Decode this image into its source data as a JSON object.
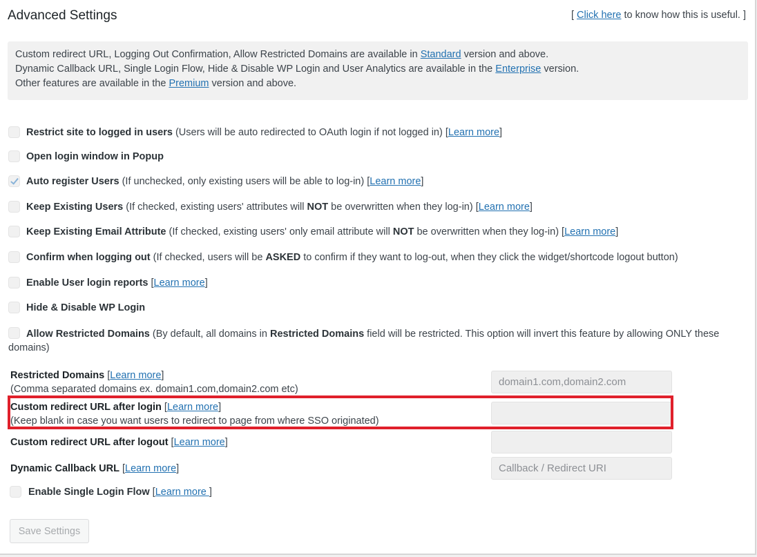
{
  "header": {
    "title": "Advanced Settings",
    "help_prefix": "[ ",
    "help_link": "Click here",
    "help_suffix": " to know how this is useful. ]"
  },
  "notice": {
    "line1_prefix": "Custom redirect URL, Logging Out Confirmation, Allow Restricted Domains are available in ",
    "line1_link": "Standard",
    "line1_suffix": " version and above.",
    "line2_prefix": "Dynamic Callback URL, Single Login Flow, Hide & Disable WP Login and User Analytics are available in the ",
    "line2_link": "Enterprise",
    "line2_suffix": " version.",
    "line3_prefix": "Other features are available in the ",
    "line3_link": "Premium",
    "line3_suffix": " version and above."
  },
  "options": {
    "restrict_site": {
      "checked": false,
      "label": "Restrict site to logged in users",
      "desc": " (Users will be auto redirected to OAuth login if not logged in) ",
      "link": "Learn more"
    },
    "popup": {
      "checked": false,
      "label": "Open login window in Popup"
    },
    "auto_register": {
      "checked": true,
      "label": "Auto register Users",
      "desc": " (If unchecked, only existing users will be able to log-in) ",
      "link": "Learn more"
    },
    "keep_users": {
      "checked": false,
      "label": "Keep Existing Users",
      "desc_a": " (If checked, existing users' attributes will ",
      "emph": "NOT",
      "desc_b": " be overwritten when they log-in) ",
      "link": "Learn more"
    },
    "keep_email": {
      "checked": false,
      "label": "Keep Existing Email Attribute",
      "desc_a": " (If checked, existing users' only email attribute will ",
      "emph": "NOT",
      "desc_b": " be overwritten when they log-in) ",
      "link": "Learn more"
    },
    "confirm_logout": {
      "checked": false,
      "label": "Confirm when logging out",
      "desc_a": " (If checked, users will be ",
      "emph": "ASKED",
      "desc_b": " to confirm if they want to log-out, when they click the widget/shortcode logout button)"
    },
    "login_reports": {
      "checked": false,
      "label": "Enable User login reports",
      "link": "Learn more"
    },
    "hide_wp_login": {
      "checked": false,
      "label": "Hide & Disable WP Login"
    },
    "allow_restricted": {
      "checked": false,
      "label": "Allow Restricted Domains",
      "desc_a": " (By default, all domains in ",
      "emph": "Restricted Domains",
      "desc_b": " field will be restricted. This option will invert this feature by allowing ONLY these domains)"
    },
    "single_login": {
      "checked": false,
      "label": "Enable Single Login Flow",
      "link": "Learn more "
    }
  },
  "fields": {
    "restricted_domains": {
      "label": "Restricted Domains",
      "link": "Learn more",
      "hint": "(Comma separated domains ex. domain1.com,domain2.com etc)",
      "value": "",
      "placeholder": "domain1.com,domain2.com"
    },
    "redirect_login": {
      "label": "Custom redirect URL after login",
      "link": "Learn more",
      "hint": "(Keep blank in case you want users to redirect to page from where SSO originated)",
      "value": "",
      "placeholder": ""
    },
    "redirect_logout": {
      "label": "Custom redirect URL after logout",
      "link": "Learn more",
      "value": "",
      "placeholder": ""
    },
    "dynamic_callback": {
      "label": "Dynamic Callback URL",
      "link": "Learn more",
      "value": "",
      "placeholder": "Callback / Redirect URI"
    }
  },
  "save_label": "Save Settings",
  "colors": {
    "link": "#2271b1",
    "highlight": "#e0202b"
  }
}
